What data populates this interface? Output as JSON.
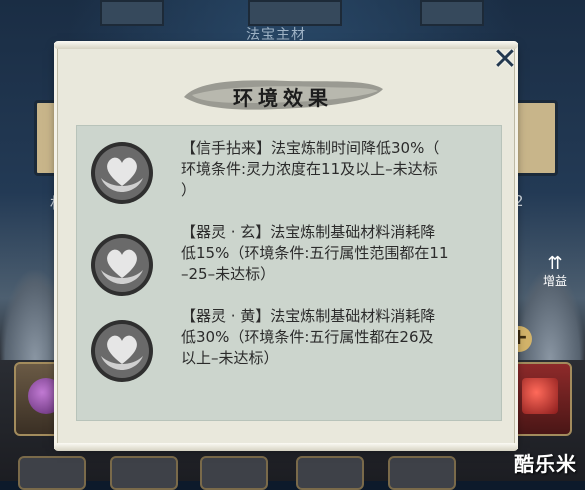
{
  "background": {
    "material_title": "法宝主材",
    "left_side_text": "材",
    "right_side_text": "2",
    "boost_label": "增益",
    "plus_symbol": "+"
  },
  "dialog": {
    "title": "环境效果",
    "close_symbol": "✕",
    "effects": [
      {
        "name": "【信手拈来】",
        "description": "法宝炼制时间降低30%（环境条件:灵力浓度在11及以上–未达标）",
        "line1": "【信手拈来】法宝炼制时间降低30%（",
        "line2": "环境条件:灵力浓度在11及以上–未达标",
        "line3": "）"
      },
      {
        "name": "【器灵·玄】",
        "description": "法宝炼制基础材料消耗降低15%（环境条件:五行属性范围都在11–25–未达标）",
        "line1": "【器灵 · 玄】法宝炼制基础材料消耗降",
        "line2": "低15%（环境条件:五行属性范围都在11",
        "line3": "–25–未达标）"
      },
      {
        "name": "【器灵·黄】",
        "description": "法宝炼制基础材料消耗降低30%（环境条件:五行属性都在26及以上–未达标）",
        "line1": "【器灵 · 黄】法宝炼制基础材料消耗降",
        "line2": "低30%（环境条件:五行属性都在26及",
        "line3": "以上–未达标）"
      }
    ]
  },
  "watermark": "酷乐米",
  "colors": {
    "panel_bg": "#e9e8dc",
    "effects_bg": "#ccd5cd",
    "text": "#2b2b2b",
    "close": "#23384f"
  }
}
